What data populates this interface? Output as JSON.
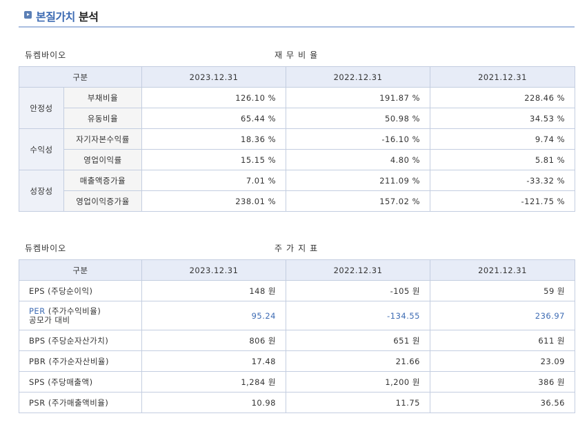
{
  "header": {
    "title_highlight": "본질가치",
    "title_rest": "분석"
  },
  "financial": {
    "company": "듀켐바이오",
    "title": "재무비율",
    "headers": [
      "구분",
      "2023.12.31",
      "2022.12.31",
      "2021.12.31"
    ],
    "groups": [
      {
        "category": "안정성",
        "rows": [
          {
            "label": "부채비율",
            "values": [
              "126.10 %",
              "191.87 %",
              "228.46 %"
            ]
          },
          {
            "label": "유동비율",
            "values": [
              "65.44 %",
              "50.98 %",
              "34.53 %"
            ]
          }
        ]
      },
      {
        "category": "수익성",
        "rows": [
          {
            "label": "자기자본수익률",
            "values": [
              "18.36 %",
              "-16.10 %",
              "9.74 %"
            ]
          },
          {
            "label": "영업이익률",
            "values": [
              "15.15 %",
              "4.80 %",
              "5.81 %"
            ]
          }
        ]
      },
      {
        "category": "성장성",
        "rows": [
          {
            "label": "매출액증가율",
            "values": [
              "7.01 %",
              "211.09 %",
              "-33.32 %"
            ]
          },
          {
            "label": "영업이익증가율",
            "values": [
              "238.01 %",
              "157.02 %",
              "-121.75 %"
            ]
          }
        ]
      }
    ]
  },
  "stock": {
    "company": "듀켐바이오",
    "title": "주가지표",
    "headers": [
      "구분",
      "2023.12.31",
      "2022.12.31",
      "2021.12.31"
    ],
    "rows": [
      {
        "label": "EPS (주당순이익)",
        "values": [
          "148 원",
          "-105 원",
          "59 원"
        ]
      },
      {
        "label_main": "PER",
        "label_paren": " (주가수익비율)",
        "label_sub": "공모가 대비",
        "values": [
          "95.24",
          "-134.55",
          "236.97"
        ]
      },
      {
        "label": "BPS (주당순자산가치)",
        "values": [
          "806 원",
          "651 원",
          "611 원"
        ]
      },
      {
        "label": "PBR (주가순자산비율)",
        "values": [
          "17.48",
          "21.66",
          "23.09"
        ]
      },
      {
        "label": "SPS (주당매출액)",
        "values": [
          "1,284 원",
          "1,200 원",
          "386 원"
        ]
      },
      {
        "label": "PSR (주가매출액비율)",
        "values": [
          "10.98",
          "11.75",
          "36.56"
        ]
      }
    ]
  }
}
